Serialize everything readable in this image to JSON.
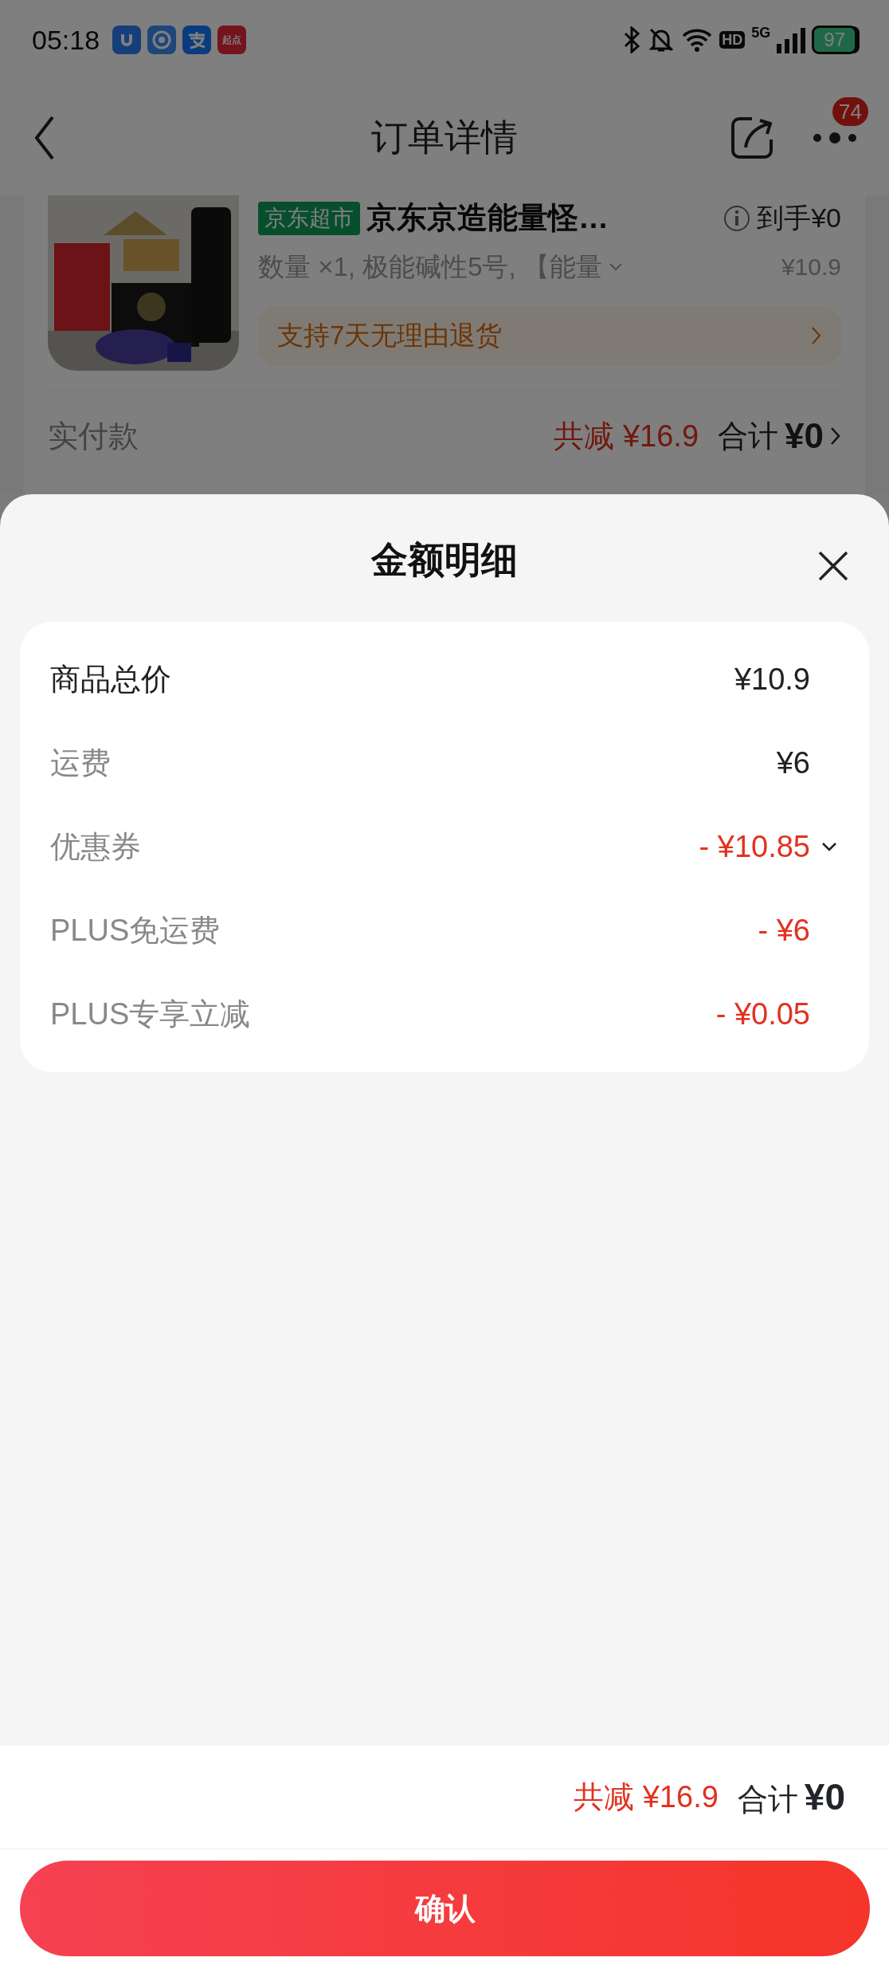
{
  "status_bar": {
    "time": "05:18",
    "app_label": "起点",
    "network": "5G",
    "hd": "HD",
    "battery": "97"
  },
  "header": {
    "title": "订单详情",
    "badge": "74"
  },
  "product": {
    "shop_tag": "京东超市",
    "title": "京东京造能量怪…",
    "price_label": "到手¥0",
    "spec": "数量 ×1, 极能碱性5号, 【能量",
    "price": "¥10.9",
    "service": "支持7天无理由退货"
  },
  "payment": {
    "label": "实付款",
    "discount": "共减 ¥16.9",
    "total_label": "合计",
    "total": "¥0"
  },
  "sheet": {
    "title": "金额明细",
    "rows": [
      {
        "label": "商品总价",
        "value": "¥10.9",
        "kind": "total",
        "expandable": false
      },
      {
        "label": "运费",
        "value": "¥6",
        "kind": "plain",
        "expandable": false
      },
      {
        "label": "优惠券",
        "value": "- ¥10.85",
        "kind": "discount",
        "expandable": true
      },
      {
        "label": "PLUS免运费",
        "value": "- ¥6",
        "kind": "discount",
        "expandable": false
      },
      {
        "label": "PLUS专享立减",
        "value": "- ¥0.05",
        "kind": "discount",
        "expandable": false
      }
    ]
  },
  "footer": {
    "discount": "共减 ¥16.9",
    "total_label": "合计",
    "total": "¥0",
    "confirm": "确认"
  }
}
